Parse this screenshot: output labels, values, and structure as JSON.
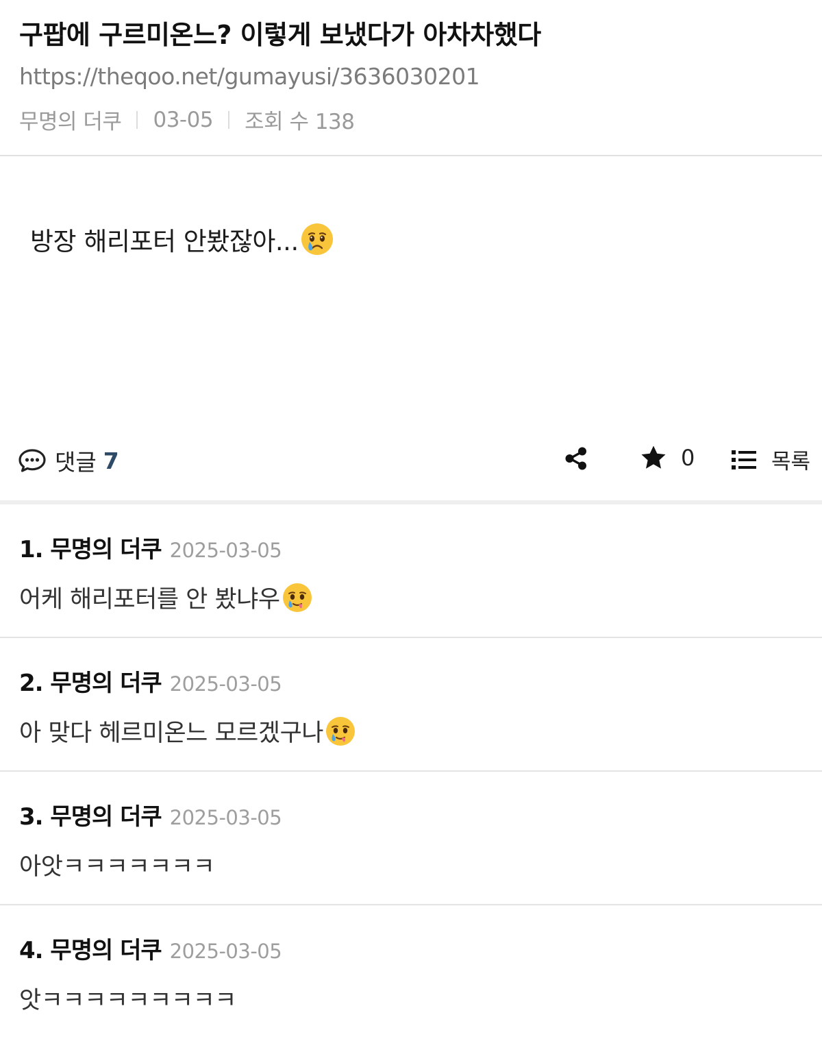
{
  "post": {
    "title": "구팝에 구르미온느? 이렇게 보냈다가 아차차했다",
    "url": "https://theqoo.net/gumayusi/3636030201",
    "author": "무명의 더쿠",
    "date": "03-05",
    "views": "조회 수 138",
    "body": "방장 해리포터 안봤잖아...",
    "body_emoji": "crying-face-icon"
  },
  "actions": {
    "comment_label": "댓글",
    "comment_count": "7",
    "vote_count": "0",
    "list_label": "목록",
    "icons": [
      "speech-bubble-icon",
      "share-icon",
      "star-icon",
      "list-icon"
    ]
  },
  "comments": [
    {
      "author": "1. 무명의 더쿠",
      "date": "2025-03-05",
      "text": "어케 해리포터를 안 봤냐우",
      "emoji": "face-holding-back-tears-icon"
    },
    {
      "author": "2. 무명의 더쿠",
      "date": "2025-03-05",
      "text": "아 맞다 헤르미온느 모르겠구나",
      "emoji": "face-holding-back-tears-icon"
    },
    {
      "author": "3. 무명의 더쿠",
      "date": "2025-03-05",
      "text": "아앗ㅋㅋㅋㅋㅋㅋㅋ",
      "emoji": ""
    },
    {
      "author": "4. 무명의 더쿠",
      "date": "2025-03-05",
      "text": "앗ㅋㅋㅋㅋㅋㅋㅋㅋㅋ",
      "emoji": ""
    }
  ],
  "colors": {
    "comment_count": "#2f4a66",
    "muted_text": "#9a9a9a",
    "divider": "#e1e1e1",
    "emoji_face": "#f9c53b"
  }
}
